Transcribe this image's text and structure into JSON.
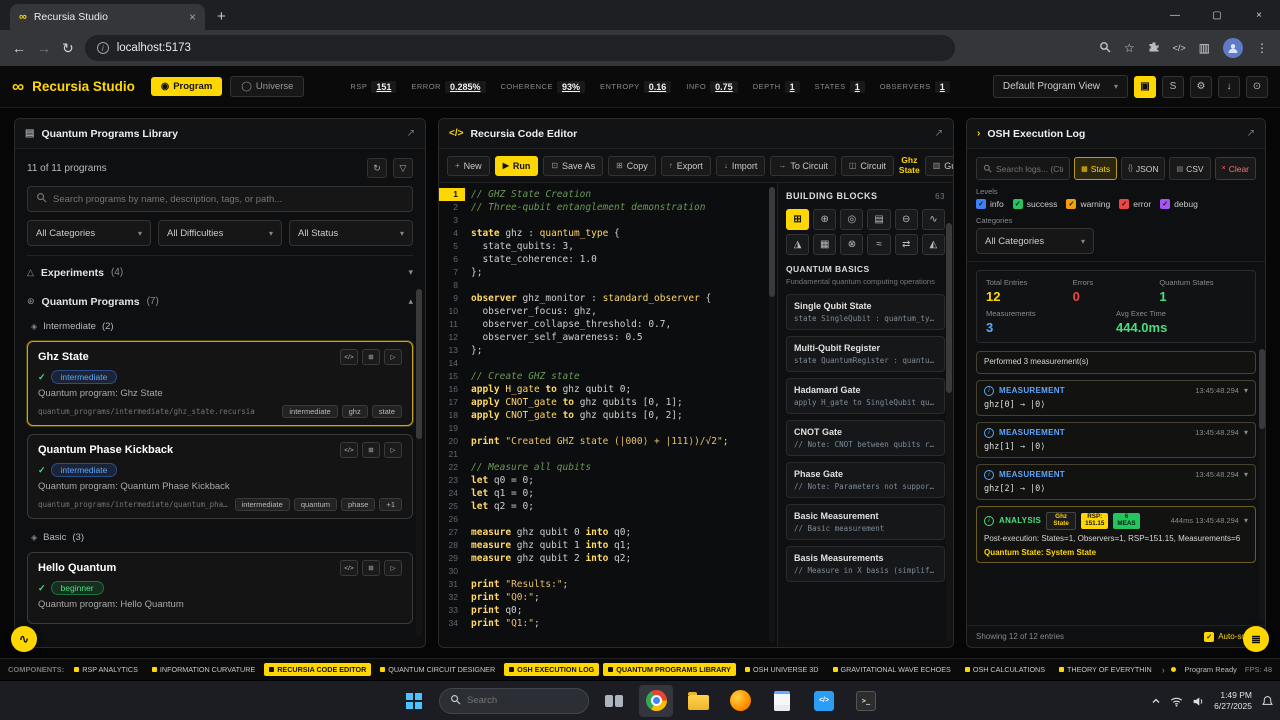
{
  "browser": {
    "tab_title": "Recursia Studio",
    "url": "localhost:5173"
  },
  "icons": {
    "infinity": "∞",
    "expand": "↗",
    "chevron_down": "▾",
    "chevron_up": "▴",
    "refresh": "↻",
    "filter": "▽",
    "check": "✓",
    "close": "×",
    "minimize": "—",
    "maximize": "▢",
    "new_tab": "+",
    "back": "←",
    "forward": "→",
    "menu_dots": "⋮",
    "star": "☆",
    "code": "</>",
    "panel": "▥",
    "library": "▤",
    "log_prompt": "›",
    "gear": "⚙",
    "download": "↓",
    "power": "⊙",
    "lock": "▣",
    "program_mode": "◉",
    "universe_mode": "◯",
    "flask": "△",
    "atom": "⊛",
    "folder_group": "◈",
    "copy": "⊞",
    "play": "▷",
    "pulse": "∿",
    "menu_lines": "≣",
    "info": "i",
    "stats": "▦",
    "json": "{}",
    "csv": "▤",
    "terminal_prompt": ">_"
  },
  "app_header": {
    "logo_text": "Recursia Studio",
    "program_btn": "Program",
    "universe_btn": "Universe",
    "metrics": [
      {
        "label": "RSP",
        "value": "151"
      },
      {
        "label": "ERROR",
        "value": "0.285%"
      },
      {
        "label": "COHERENCE",
        "value": "93%"
      },
      {
        "label": "ENTROPY",
        "value": "0.16"
      },
      {
        "label": "INFO",
        "value": "0.75"
      },
      {
        "label": "DEPTH",
        "value": "1"
      },
      {
        "label": "STATES",
        "value": "1"
      },
      {
        "label": "OBSERVERS",
        "value": "1"
      }
    ],
    "view_dropdown": "Default Program View",
    "s_btn": "S"
  },
  "library": {
    "title": "Quantum Programs Library",
    "count_text": "11 of 11 programs",
    "search_placeholder": "Search programs by name, description, tags, or path...",
    "filters": [
      "All Categories",
      "All Difficulties",
      "All Status"
    ],
    "sections": [
      {
        "label": "Experiments",
        "count": "(4)"
      },
      {
        "label": "Quantum Programs",
        "count": "(7)"
      }
    ],
    "groups": [
      {
        "label": "Intermediate",
        "count": "(2)"
      },
      {
        "label": "Basic",
        "count": "(3)"
      }
    ],
    "programs": [
      {
        "name": "Ghz State",
        "difficulty": "intermediate",
        "description": "Quantum program: Ghz State",
        "path": "quantum_programs/intermediate/ghz_state.recursia",
        "tags": [
          "intermediate",
          "ghz",
          "state"
        ]
      },
      {
        "name": "Quantum Phase Kickback",
        "difficulty": "intermediate",
        "description": "Quantum program: Quantum Phase Kickback",
        "path": "quantum_programs/intermediate/quantum_phase_k...",
        "tags": [
          "intermediate",
          "quantum",
          "phase",
          "+1"
        ]
      },
      {
        "name": "Hello Quantum",
        "difficulty": "beginner",
        "description": "Quantum program: Hello Quantum"
      }
    ]
  },
  "editor": {
    "title": "Recursia Code Editor",
    "toolbar": [
      {
        "label": "New",
        "icon": "+"
      },
      {
        "label": "Run",
        "icon": "▶",
        "style": "primary"
      },
      {
        "label": "Save As",
        "icon": "⊡"
      },
      {
        "label": "Copy",
        "icon": "⊞"
      },
      {
        "label": "Export",
        "icon": "↑"
      },
      {
        "label": "Import",
        "icon": "↓"
      },
      {
        "label": "To Circuit",
        "icon": "→"
      },
      {
        "label": "Circuit",
        "icon": "◫"
      }
    ],
    "current_program": "Ghz State",
    "guide_label": "Guide",
    "code": [
      [
        [
          "c",
          "// GHZ State Creation"
        ]
      ],
      [
        [
          "c",
          "// Three-qubit entanglement demonstration"
        ]
      ],
      [],
      [
        [
          "k",
          "state"
        ],
        [
          "p",
          " ghz : "
        ],
        [
          "t",
          "quantum_type"
        ],
        [
          "p",
          " {"
        ]
      ],
      [
        [
          "p",
          "  state_qubits: "
        ],
        [
          "n",
          "3"
        ],
        [
          "p",
          ","
        ]
      ],
      [
        [
          "p",
          "  state_coherence: "
        ],
        [
          "n",
          "1.0"
        ]
      ],
      [
        [
          "p",
          "};"
        ]
      ],
      [],
      [
        [
          "k",
          "observer"
        ],
        [
          "p",
          " ghz_monitor : "
        ],
        [
          "t",
          "standard_observer"
        ],
        [
          "p",
          " {"
        ]
      ],
      [
        [
          "p",
          "  observer_focus: ghz,"
        ]
      ],
      [
        [
          "p",
          "  observer_collapse_threshold: "
        ],
        [
          "n",
          "0.7"
        ],
        [
          "p",
          ","
        ]
      ],
      [
        [
          "p",
          "  observer_self_awareness: "
        ],
        [
          "n",
          "0.5"
        ]
      ],
      [
        [
          "p",
          "};"
        ]
      ],
      [],
      [
        [
          "c",
          "// Create GHZ state"
        ]
      ],
      [
        [
          "k",
          "apply"
        ],
        [
          "p",
          " "
        ],
        [
          "f",
          "H_gate"
        ],
        [
          "p",
          " "
        ],
        [
          "k",
          "to"
        ],
        [
          "p",
          " ghz qubit "
        ],
        [
          "n",
          "0"
        ],
        [
          "p",
          ";"
        ]
      ],
      [
        [
          "k",
          "apply"
        ],
        [
          "p",
          " "
        ],
        [
          "f",
          "CNOT_gate"
        ],
        [
          "p",
          " "
        ],
        [
          "k",
          "to"
        ],
        [
          "p",
          " ghz qubits ["
        ],
        [
          "n",
          "0"
        ],
        [
          "p",
          ", "
        ],
        [
          "n",
          "1"
        ],
        [
          "p",
          "];"
        ]
      ],
      [
        [
          "k",
          "apply"
        ],
        [
          "p",
          " "
        ],
        [
          "f",
          "CNOT_gate"
        ],
        [
          "p",
          " "
        ],
        [
          "k",
          "to"
        ],
        [
          "p",
          " ghz qubits ["
        ],
        [
          "n",
          "0"
        ],
        [
          "p",
          ", "
        ],
        [
          "n",
          "2"
        ],
        [
          "p",
          "];"
        ]
      ],
      [],
      [
        [
          "k",
          "print"
        ],
        [
          "p",
          " "
        ],
        [
          "s",
          "\"Created GHZ state (|000⟩ + |111⟩)/√2\""
        ],
        [
          "p",
          ";"
        ]
      ],
      [],
      [
        [
          "c",
          "// Measure all qubits"
        ]
      ],
      [
        [
          "k",
          "let"
        ],
        [
          "p",
          " q0 = "
        ],
        [
          "n",
          "0"
        ],
        [
          "p",
          ";"
        ]
      ],
      [
        [
          "k",
          "let"
        ],
        [
          "p",
          " q1 = "
        ],
        [
          "n",
          "0"
        ],
        [
          "p",
          ";"
        ]
      ],
      [
        [
          "k",
          "let"
        ],
        [
          "p",
          " q2 = "
        ],
        [
          "n",
          "0"
        ],
        [
          "p",
          ";"
        ]
      ],
      [],
      [
        [
          "k",
          "measure"
        ],
        [
          "p",
          " ghz qubit "
        ],
        [
          "n",
          "0"
        ],
        [
          "p",
          " "
        ],
        [
          "k",
          "into"
        ],
        [
          "p",
          " q0;"
        ]
      ],
      [
        [
          "k",
          "measure"
        ],
        [
          "p",
          " ghz qubit "
        ],
        [
          "n",
          "1"
        ],
        [
          "p",
          " "
        ],
        [
          "k",
          "into"
        ],
        [
          "p",
          " q1;"
        ]
      ],
      [
        [
          "k",
          "measure"
        ],
        [
          "p",
          " ghz qubit "
        ],
        [
          "n",
          "2"
        ],
        [
          "p",
          " "
        ],
        [
          "k",
          "into"
        ],
        [
          "p",
          " q2;"
        ]
      ],
      [],
      [
        [
          "k",
          "print"
        ],
        [
          "p",
          " "
        ],
        [
          "s",
          "\"Results:\""
        ],
        [
          "p",
          ";"
        ]
      ],
      [
        [
          "k",
          "print"
        ],
        [
          "p",
          " "
        ],
        [
          "s",
          "\"Q0:\""
        ],
        [
          "p",
          ";"
        ]
      ],
      [
        [
          "k",
          "print"
        ],
        [
          "p",
          " q0;"
        ]
      ],
      [
        [
          "k",
          "print"
        ],
        [
          "p",
          " "
        ],
        [
          "s",
          "\"Q1:\""
        ],
        [
          "p",
          ";"
        ]
      ]
    ],
    "blocks": {
      "title": "BUILDING BLOCKS",
      "count": "63",
      "icons": [
        "⊞",
        "⊕",
        "◎",
        "▤",
        "⊖",
        "∿",
        "◮",
        "▦",
        "⊗",
        "≈",
        "⇄",
        "◭"
      ],
      "section": "QUANTUM BASICS",
      "section_sub": "Fundamental quantum computing operations",
      "items": [
        {
          "name": "Single Qubit State",
          "snippet": "state SingleQubit : quantum_type {"
        },
        {
          "name": "Multi-Qubit Register",
          "snippet": "state QuantumRegister : quantum_..."
        },
        {
          "name": "Hadamard Gate",
          "snippet": "apply H_gate to SingleQubit qub..."
        },
        {
          "name": "CNOT Gate",
          "snippet": "// Note: CNOT between qubits req..."
        },
        {
          "name": "Phase Gate",
          "snippet": "// Note: Parameters not supporte..."
        },
        {
          "name": "Basic Measurement",
          "snippet": "// Basic measurement"
        },
        {
          "name": "Basis Measurements",
          "snippet": "// Measure in X basis (simplified)"
        }
      ]
    }
  },
  "log": {
    "title": "OSH Execution Log",
    "search_placeholder": "Search logs... (Ctrl",
    "buttons": {
      "stats": "Stats",
      "json": "JSON",
      "csv": "CSV",
      "clear": "Clear"
    },
    "levels_label": "Levels",
    "levels": [
      {
        "label": "info",
        "color": "#3b82f6"
      },
      {
        "label": "success",
        "color": "#22c55e"
      },
      {
        "label": "warning",
        "color": "#f59e0b"
      },
      {
        "label": "error",
        "color": "#ef4444"
      },
      {
        "label": "debug",
        "color": "#a855f7"
      }
    ],
    "categories_label": "Categories",
    "categories_value": "All Categories",
    "stats": [
      {
        "label": "Total Entries",
        "value": "12",
        "color": "#ffd700"
      },
      {
        "label": "Errors",
        "value": "0",
        "color": "#ef4444"
      },
      {
        "label": "Quantum States",
        "value": "1",
        "color": "#4ade80"
      },
      {
        "label": "Measurements",
        "value": "3",
        "color": "#60a5fa"
      },
      {
        "label": "Avg Exec Time",
        "value": "444.0ms",
        "color": "#4ade80"
      }
    ],
    "message_entry": "Performed 3 measurement(s)",
    "measurements": [
      {
        "label": "MEASUREMENT",
        "time": "13:45:48.294",
        "detail": "ghz[0] → |0⟩"
      },
      {
        "label": "MEASUREMENT",
        "time": "13:45:48.294",
        "detail": "ghz[1] → |0⟩"
      },
      {
        "label": "MEASUREMENT",
        "time": "13:45:48.294",
        "detail": "ghz[2] → |0⟩"
      }
    ],
    "analysis": {
      "label": "ANALYSIS",
      "program": "Ghz State",
      "rsp_badge_top": "RSP:",
      "rsp_badge_val": "151.15",
      "meas_badge_top": "6",
      "meas_badge_val": "MEAS",
      "duration": "444ms",
      "time": "13:45:48.294",
      "body": "Post-execution: States=1, Observers=1, RSP=151.15, Measurements=6",
      "link": "Quantum State: System State"
    },
    "footer_left": "Showing 12 of 12 entries",
    "autoscroll_label": "Auto-scroll"
  },
  "statusbar": {
    "label": "COMPONENTS:",
    "items": [
      {
        "label": "RSP ANALYTICS",
        "active": false
      },
      {
        "label": "INFORMATION CURVATURE",
        "active": false
      },
      {
        "label": "RECURSIA CODE EDITOR",
        "active": true
      },
      {
        "label": "QUANTUM CIRCUIT DESIGNER",
        "active": false
      },
      {
        "label": "OSH EXECUTION LOG",
        "active": true
      },
      {
        "label": "QUANTUM PROGRAMS LIBRARY",
        "active": true
      },
      {
        "label": "OSH UNIVERSE 3D",
        "active": false
      },
      {
        "label": "GRAVITATIONAL WAVE ECHOES",
        "active": false
      },
      {
        "label": "OSH CALCULATIONS",
        "active": false
      },
      {
        "label": "THEORY OF EVERYTHIN",
        "active": false
      }
    ],
    "more": "›",
    "ready": "Program Ready",
    "fps": "FPS: 48"
  },
  "taskbar": {
    "search_placeholder": "Search",
    "time": "1:49 PM",
    "date": "6/27/2025"
  }
}
